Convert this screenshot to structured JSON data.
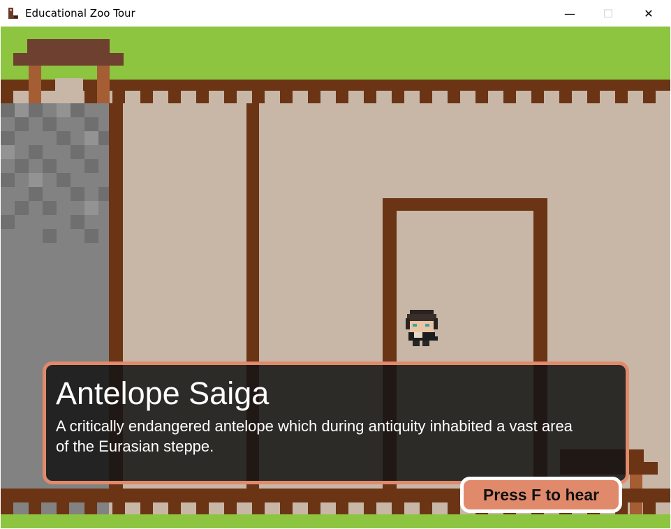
{
  "window": {
    "title": "Educational Zoo Tour",
    "minimize_glyph": "—",
    "maximize_glyph": "☐",
    "close_glyph": "✕"
  },
  "dialog": {
    "title": "Antelope Saiga",
    "text": "A critically endangered antelope which during antiquity inhabited a vast area of the Eurasian steppe.",
    "action_label": "Press F to hear"
  },
  "colors": {
    "grass": "#8dc440",
    "floor": "#c8b7a6",
    "wall": "#6a3415",
    "stone": "#828282",
    "dialog_border": "#e08a6b",
    "button_fill": "#e08a6b"
  },
  "icons": [
    "app-icon",
    "minimize-icon",
    "maximize-icon",
    "close-icon",
    "player-character"
  ]
}
